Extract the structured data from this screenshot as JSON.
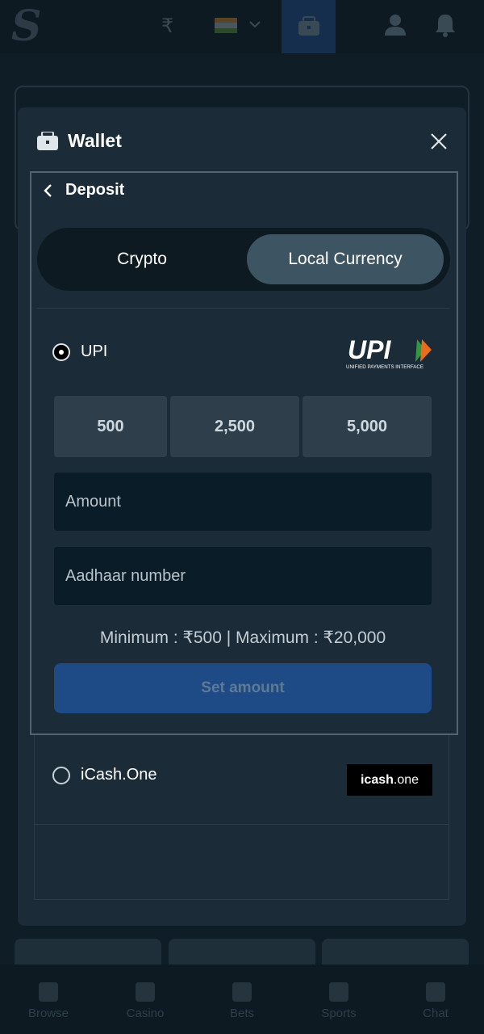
{
  "topbar": {
    "currency_symbol": "₹",
    "logo_letter": "S"
  },
  "bottom_nav": {
    "items": [
      {
        "label": "Browse"
      },
      {
        "label": "Casino"
      },
      {
        "label": "Bets"
      },
      {
        "label": "Sports"
      },
      {
        "label": "Chat"
      }
    ]
  },
  "wallet": {
    "title": "Wallet",
    "deposit": {
      "title": "Deposit",
      "tabs": {
        "crypto": "Crypto",
        "local": "Local Currency",
        "selected": "Local Currency"
      },
      "upi": {
        "label": "UPI",
        "selected": true,
        "logo_text": "UPI",
        "logo_subtext": "UNIFIED PAYMENTS INTERFACE",
        "presets": [
          "500",
          "2,500",
          "5,000"
        ],
        "amount_placeholder": "Amount",
        "aadhaar_placeholder": "Aadhaar number",
        "limits": "Minimum : ₹500 | Maximum : ₹20,000",
        "submit_label": "Set amount"
      },
      "icash": {
        "label": "iCash.One",
        "selected": false,
        "logo_bold": "icash",
        "logo_light": ".one"
      }
    }
  },
  "colors": {
    "modal_bg": "#1b2b37",
    "toggle_active": "#3d5463",
    "button_primary": "#1e4a85"
  }
}
